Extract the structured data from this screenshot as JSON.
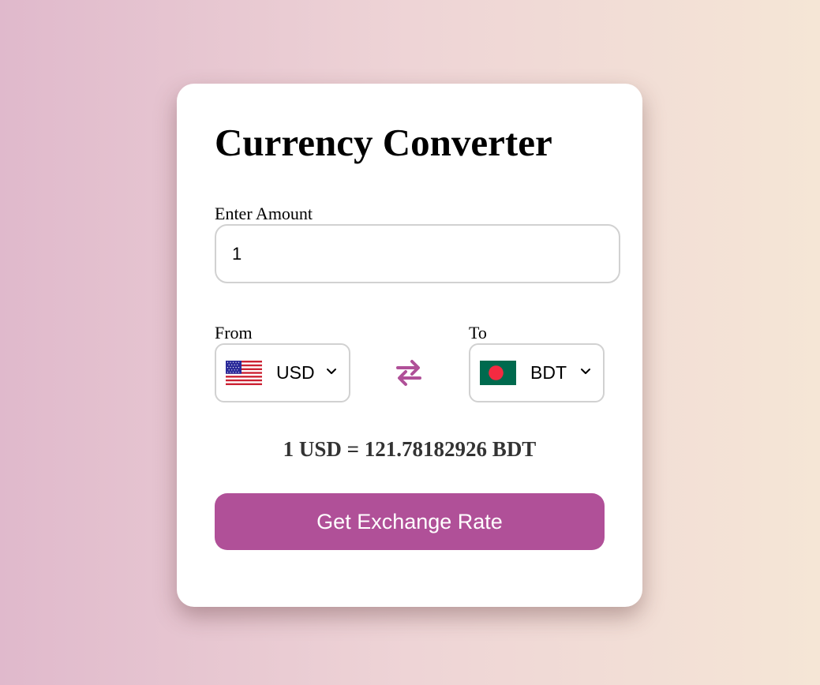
{
  "converter": {
    "title": "Currency Converter",
    "amount_label": "Enter Amount",
    "amount_value": "1",
    "from_label": "From",
    "to_label": "To",
    "from_currency": {
      "code": "USD",
      "flag_icon": "us-flag-icon"
    },
    "to_currency": {
      "code": "BDT",
      "flag_icon": "bd-flag-icon"
    },
    "rate_text": "1 USD = 121.78182926 BDT",
    "button_label": "Get Exchange Rate"
  },
  "colors": {
    "accent": "#b05098",
    "border": "#d1d1d1",
    "bd_green": "#006a4e",
    "bd_red": "#f42a41"
  }
}
